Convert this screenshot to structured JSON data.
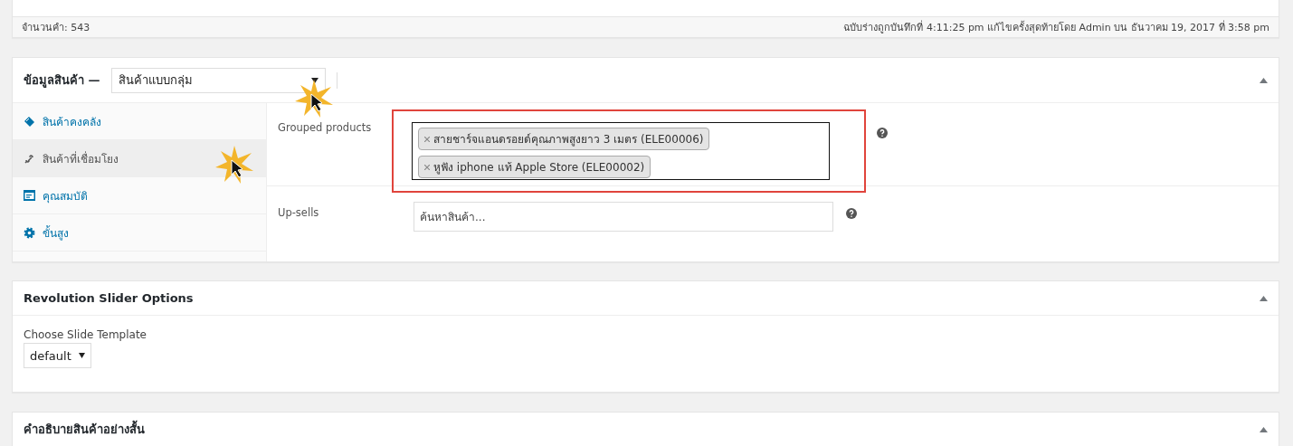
{
  "top_box": {
    "word_count": "จำนวนคำ: 543",
    "draft_status": "ฉบับร่างถูกบันทึกที่ 4:11:25 pm แก้ไขครั้งสุดท้ายโดย Admin บน ธันวาคม 19, 2017 ที่ 3:58 pm"
  },
  "product_data": {
    "title": "ข้อมูลสินค้า —",
    "type_select": "สินค้าแบบกลุ่ม",
    "tabs": [
      {
        "label": "สินค้าคงคลัง",
        "selected": false
      },
      {
        "label": "สินค้าที่เชื่อมโยง",
        "selected": true
      },
      {
        "label": "คุณสมบัติ",
        "selected": false
      },
      {
        "label": "ขั้นสูง",
        "selected": false
      }
    ],
    "fields": [
      {
        "label": "Grouped products",
        "kind": "tags",
        "highlighted": true,
        "tags": [
          "สายชาร์จแอนดรอยด์คุณภาพสูงยาว 3 เมตร (ELE00006)",
          "หูฟัง iphone แท้ Apple Store (ELE00002)"
        ]
      },
      {
        "label": "Up-sells",
        "kind": "search",
        "highlighted": false,
        "placeholder": "ค้นหาสินค้า..."
      }
    ]
  },
  "slider_box": {
    "title": "Revolution Slider Options",
    "label": "Choose Slide Template",
    "select": "default"
  },
  "short_desc_box": {
    "title": "คำอธิบายสินค้าอย่างสั้น"
  }
}
